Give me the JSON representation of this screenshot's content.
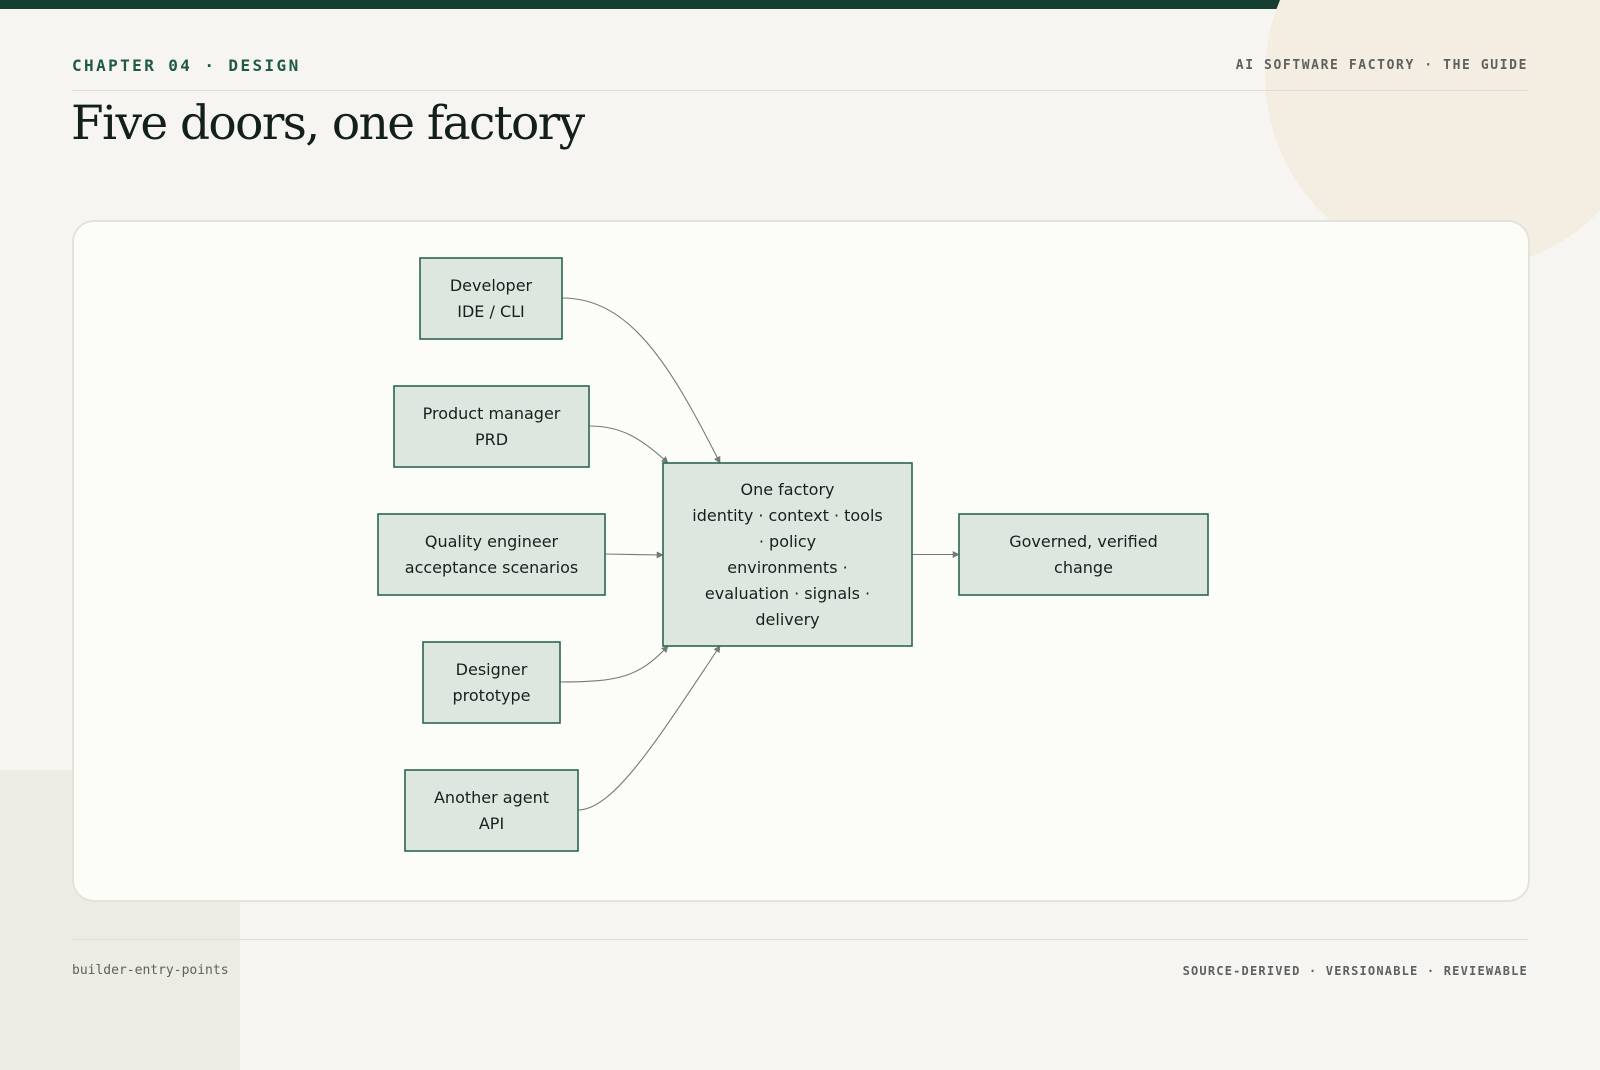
{
  "header": {
    "chapter": "CHAPTER 04 · DESIGN",
    "guide": "AI SOFTWARE FACTORY · THE GUIDE",
    "title": "Five doors, one factory"
  },
  "diagram": {
    "nodes": [
      {
        "id": "developer",
        "lines": [
          "Developer",
          "IDE / CLI"
        ]
      },
      {
        "id": "product-manager",
        "lines": [
          "Product manager",
          "PRD"
        ]
      },
      {
        "id": "quality-engineer",
        "lines": [
          "Quality engineer",
          "acceptance scenarios"
        ]
      },
      {
        "id": "designer",
        "lines": [
          "Designer",
          "prototype"
        ]
      },
      {
        "id": "another-agent",
        "lines": [
          "Another agent",
          "API"
        ]
      },
      {
        "id": "factory",
        "lines": [
          "One factory",
          "identity · context · tools",
          "· policy",
          "environments ·",
          "evaluation · signals ·",
          "delivery"
        ]
      },
      {
        "id": "output",
        "lines": [
          "Governed, verified",
          "change"
        ]
      }
    ],
    "edges": [
      {
        "from": "developer",
        "to": "factory"
      },
      {
        "from": "product-manager",
        "to": "factory"
      },
      {
        "from": "quality-engineer",
        "to": "factory"
      },
      {
        "from": "designer",
        "to": "factory"
      },
      {
        "from": "another-agent",
        "to": "factory"
      },
      {
        "from": "factory",
        "to": "output"
      }
    ]
  },
  "footer": {
    "slug": "builder-entry-points",
    "tags": "SOURCE-DERIVED · VERSIONABLE · REVIEWABLE"
  }
}
